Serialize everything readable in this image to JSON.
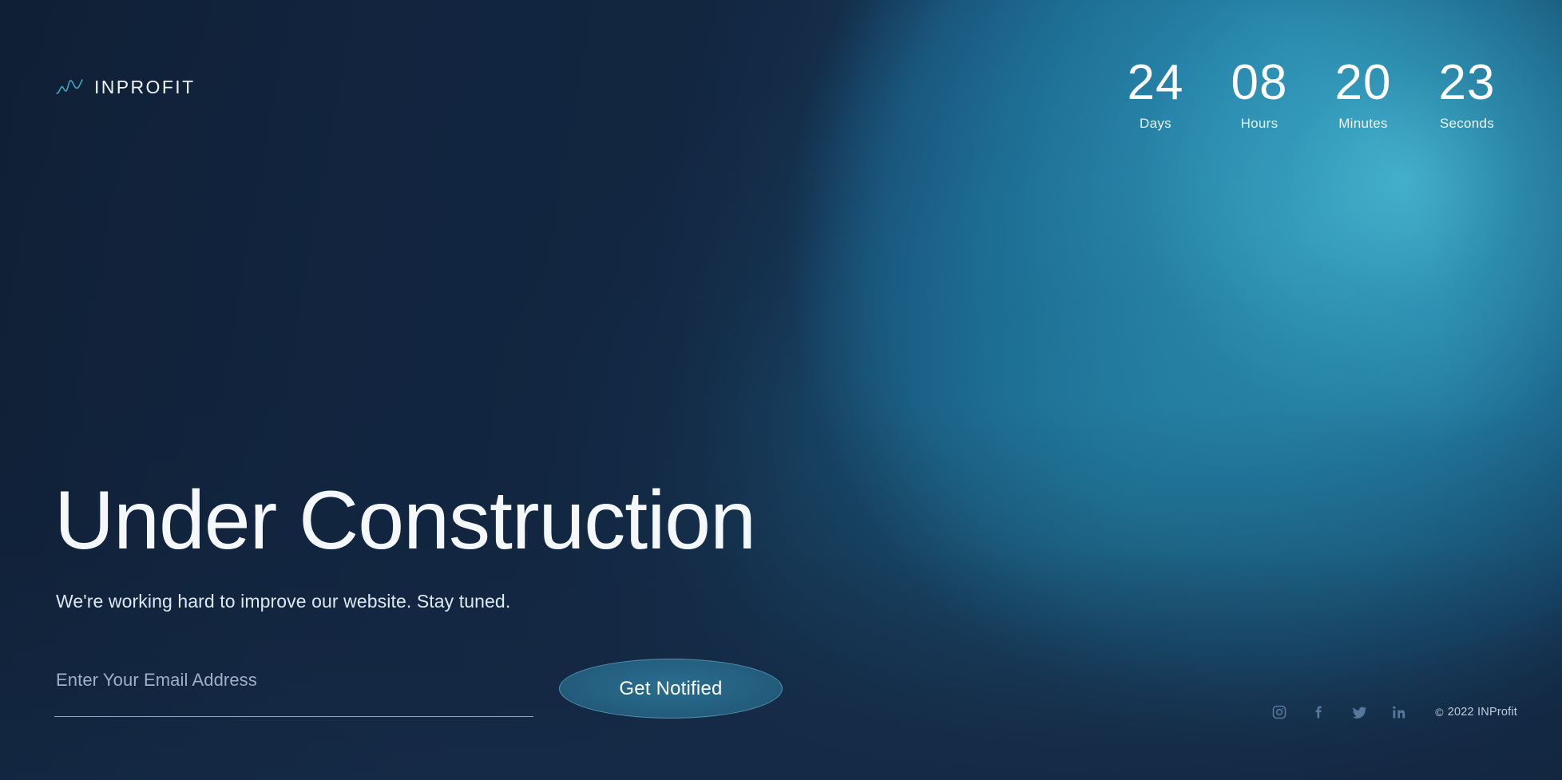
{
  "brand": {
    "name": "INPROFIT",
    "mark_icon": "wave-line-chart-icon"
  },
  "countdown": {
    "units": [
      {
        "value": "24",
        "label": "Days"
      },
      {
        "value": "08",
        "label": "Hours"
      },
      {
        "value": "20",
        "label": "Minutes"
      },
      {
        "value": "23",
        "label": "Seconds"
      }
    ]
  },
  "hero": {
    "title": "Under Construction",
    "subtitle": "We're working hard to improve our website. Stay tuned."
  },
  "subscribe": {
    "email_value": "",
    "email_placeholder": "Enter Your Email Address",
    "button_label": "Get Notified"
  },
  "footer": {
    "social": [
      {
        "name": "instagram-icon",
        "label": "Instagram"
      },
      {
        "name": "facebook-icon",
        "label": "Facebook"
      },
      {
        "name": "twitter-icon",
        "label": "Twitter"
      },
      {
        "name": "linkedin-icon",
        "label": "LinkedIn"
      }
    ],
    "copyright_symbol": "©",
    "copyright": "2022 INProfit"
  },
  "colors": {
    "background_dark": "#152a46",
    "accent_teal": "#2a87ac",
    "glow_bright": "#4fc1d8",
    "text_primary": "#f4f8fb",
    "text_muted": "#9fb0c6",
    "button_fill": "#245f80",
    "button_border": "#4f93ad",
    "social_icon": "#56789c"
  }
}
